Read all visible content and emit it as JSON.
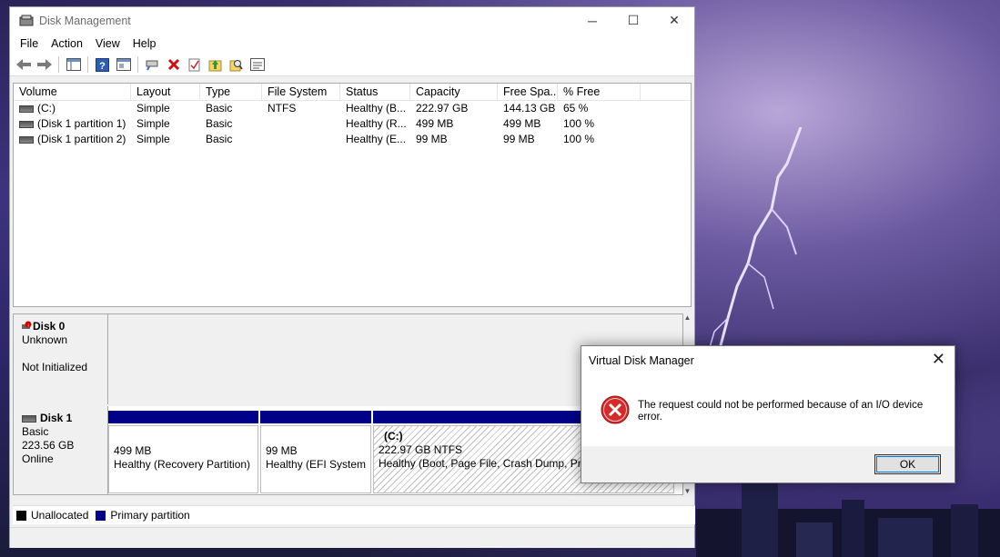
{
  "window": {
    "title": "Disk Management",
    "minimize_glyph": "─",
    "maximize_glyph": "☐",
    "close_glyph": "✕"
  },
  "menu": [
    "File",
    "Action",
    "View",
    "Help"
  ],
  "toolbar_icons": [
    "back-arrow-icon",
    "forward-arrow-icon",
    "console-tree-icon",
    "help-icon",
    "properties-icon",
    "connect-icon",
    "delete-icon",
    "checklist-icon",
    "export-icon",
    "search-icon",
    "settings-icon"
  ],
  "volumes": {
    "headers": [
      "Volume",
      "Layout",
      "Type",
      "File System",
      "Status",
      "Capacity",
      "Free Spa...",
      "% Free"
    ],
    "rows": [
      [
        "(C:)",
        "Simple",
        "Basic",
        "NTFS",
        "Healthy (B...",
        "222.97 GB",
        "144.13 GB",
        "65 %"
      ],
      [
        "(Disk 1 partition 1)",
        "Simple",
        "Basic",
        "",
        "Healthy (R...",
        "499 MB",
        "499 MB",
        "100 %"
      ],
      [
        "(Disk 1 partition 2)",
        "Simple",
        "Basic",
        "",
        "Healthy (E...",
        "99 MB",
        "99 MB",
        "100 %"
      ]
    ]
  },
  "disks": [
    {
      "name": "Disk 0",
      "type": "Unknown",
      "size": "",
      "state": "Not Initialized"
    },
    {
      "name": "Disk 1",
      "type": "Basic",
      "size": "223.56 GB",
      "state": "Online"
    }
  ],
  "partitions": [
    {
      "label": "",
      "size": "499 MB",
      "status": "Healthy (Recovery Partition)"
    },
    {
      "label": "",
      "size": "99 MB",
      "status": "Healthy (EFI System"
    },
    {
      "label": "(C:)",
      "size": "222.97 GB NTFS",
      "status": "Healthy (Boot, Page File, Crash Dump, Pri"
    }
  ],
  "legend": [
    {
      "label": "Unallocated",
      "color": "#000000"
    },
    {
      "label": "Primary partition",
      "color": "#000088"
    }
  ],
  "dialog": {
    "title": "Virtual Disk Manager",
    "close_glyph": "✕",
    "message": "The request could not be performed because of an I/O device error.",
    "ok_label": "OK"
  },
  "scroll": {
    "up": "▲",
    "down": "▼"
  }
}
